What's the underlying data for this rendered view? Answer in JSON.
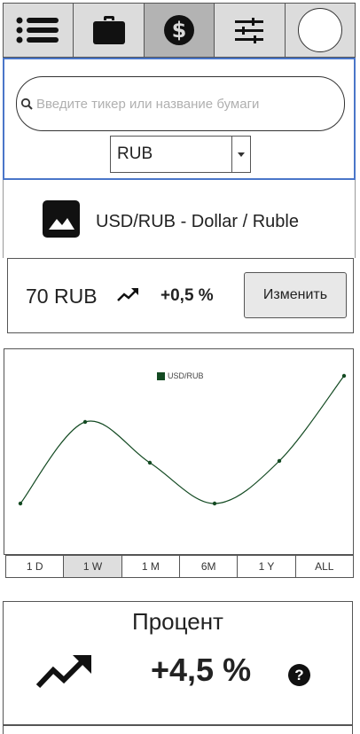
{
  "nav": {
    "items": [
      {
        "icon": "list-icon"
      },
      {
        "icon": "briefcase-icon"
      },
      {
        "icon": "dollar-icon",
        "active": true
      },
      {
        "icon": "sliders-icon"
      },
      {
        "icon": "avatar"
      }
    ]
  },
  "search": {
    "placeholder": "Введите тикер или название бумаги",
    "value": ""
  },
  "currency": {
    "selected": "RUB"
  },
  "instrument": {
    "title": "USD/RUB - Dollar / Ruble",
    "icon": "image-icon"
  },
  "price": {
    "value": "70 RUB",
    "change": "+0,5 %",
    "edit_label": "Изменить"
  },
  "chart_data": {
    "type": "line",
    "series": [
      {
        "name": "USD/RUB",
        "color": "#134a22",
        "values": [
          0.22,
          0.68,
          0.45,
          0.22,
          0.46,
          0.94
        ]
      }
    ],
    "ylim": [
      0,
      1
    ],
    "grid": false,
    "legend": "top-center"
  },
  "ranges": {
    "items": [
      {
        "label": "1 D"
      },
      {
        "label": "1 W",
        "active": true
      },
      {
        "label": "1 M"
      },
      {
        "label": "6M"
      },
      {
        "label": "1 Y"
      },
      {
        "label": "ALL"
      }
    ]
  },
  "percent": {
    "title": "Процент",
    "value": "+4,5 %",
    "help": "?"
  },
  "colors": {
    "accent_border": "#4a76c9",
    "series": "#134a22",
    "nav_active": "#b3b3b3"
  }
}
